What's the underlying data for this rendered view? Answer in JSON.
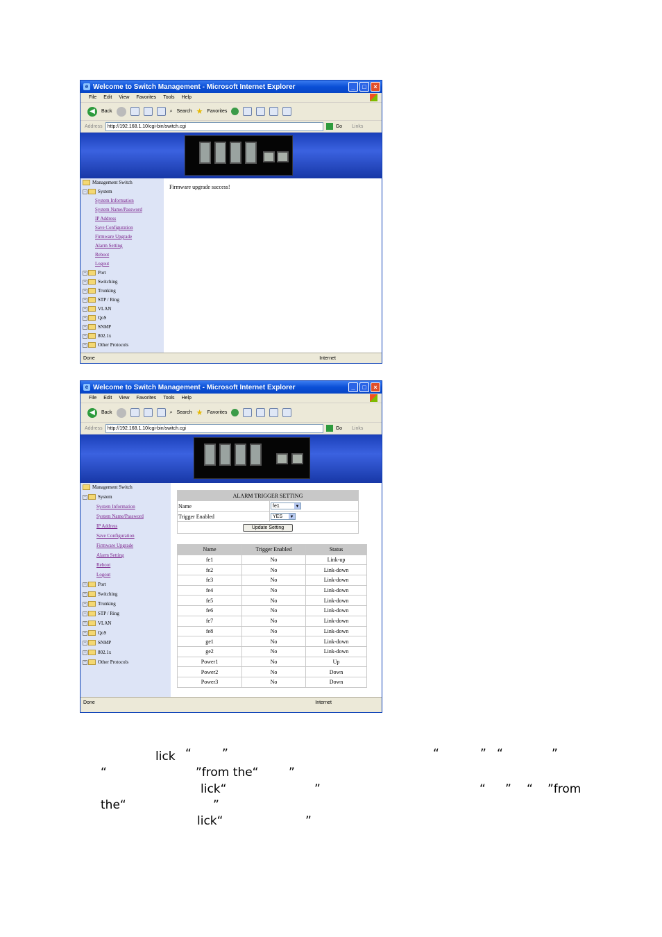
{
  "window1": {
    "title": "Welcome to Switch Management - Microsoft Internet Explorer",
    "menu": [
      "File",
      "Edit",
      "View",
      "Favorites",
      "Tools",
      "Help"
    ],
    "toolbar": {
      "back": "Back",
      "search": "Search",
      "favorites": "Favorites"
    },
    "address_label": "Address",
    "url": "http://192.168.1.10/cgi-bin/switch.cgi",
    "go": "Go",
    "links": "Links",
    "message": "Firmware upgrade success!",
    "status_left": "Done",
    "status_right": "Internet"
  },
  "window2": {
    "title": "Welcome to Switch Management - Microsoft Internet Explorer",
    "menu": [
      "File",
      "Edit",
      "View",
      "Favorites",
      "Tools",
      "Help"
    ],
    "toolbar": {
      "back": "Back",
      "search": "Search",
      "favorites": "Favorites"
    },
    "address_label": "Address",
    "url": "http://192.168.1.10/cgi-bin/switch.cgi",
    "go": "Go",
    "links": "Links",
    "status_left": "Done",
    "status_right": "Internet"
  },
  "tree": {
    "root": "Management Switch",
    "system": "System",
    "system_links": [
      "System Information",
      "System Name/Password",
      "IP Address",
      "Save Configuration",
      "Firmware Upgrade",
      "Alarm Setting",
      "Reboot",
      "Logout"
    ],
    "folders": [
      "Port",
      "Switching",
      "Trunking",
      "STP / Ring",
      "VLAN",
      "QoS",
      "SNMP",
      "802.1x",
      "Other Protocols"
    ]
  },
  "alarm_form": {
    "title": "ALARM TRIGGER SETTING",
    "name_label": "Name",
    "name_value": "fe1",
    "trigger_label": "Trigger Enabled",
    "trigger_value": "YES",
    "update_button": "Update Setting"
  },
  "status_table": {
    "headers": [
      "Name",
      "Trigger Enabled",
      "Status"
    ],
    "rows": [
      [
        "fe1",
        "No",
        "Link-up"
      ],
      [
        "fe2",
        "No",
        "Link-down"
      ],
      [
        "fe3",
        "No",
        "Link-down"
      ],
      [
        "fe4",
        "No",
        "Link-down"
      ],
      [
        "fe5",
        "No",
        "Link-down"
      ],
      [
        "fe6",
        "No",
        "Link-down"
      ],
      [
        "fe7",
        "No",
        "Link-down"
      ],
      [
        "fe8",
        "No",
        "Link-down"
      ],
      [
        "ge1",
        "No",
        "Link-down"
      ],
      [
        "ge2",
        "No",
        "Link-down"
      ],
      [
        "Power1",
        "No",
        "Up"
      ],
      [
        "Power2",
        "No",
        "Down"
      ],
      [
        "Power3",
        "No",
        "Down"
      ]
    ]
  },
  "caption": {
    "line1_a": "lick",
    "line1_q1": "“",
    "line1_q2": "”",
    "line1_q3": "“",
    "line1_q4": "”",
    "line1_q5": "“",
    "line1_q6": "”",
    "line2_q1": "“",
    "line2_b": "”from the“",
    "line2_q2": "”",
    "line3_a": "lick“",
    "line3_q1": "”",
    "line3_q2": "“",
    "line3_q3": "”",
    "line3_q4": "“",
    "line3_b": "”from",
    "line4_a": "the“",
    "line4_q1": "”",
    "line5_a": "lick“",
    "line5_q1": "”"
  }
}
